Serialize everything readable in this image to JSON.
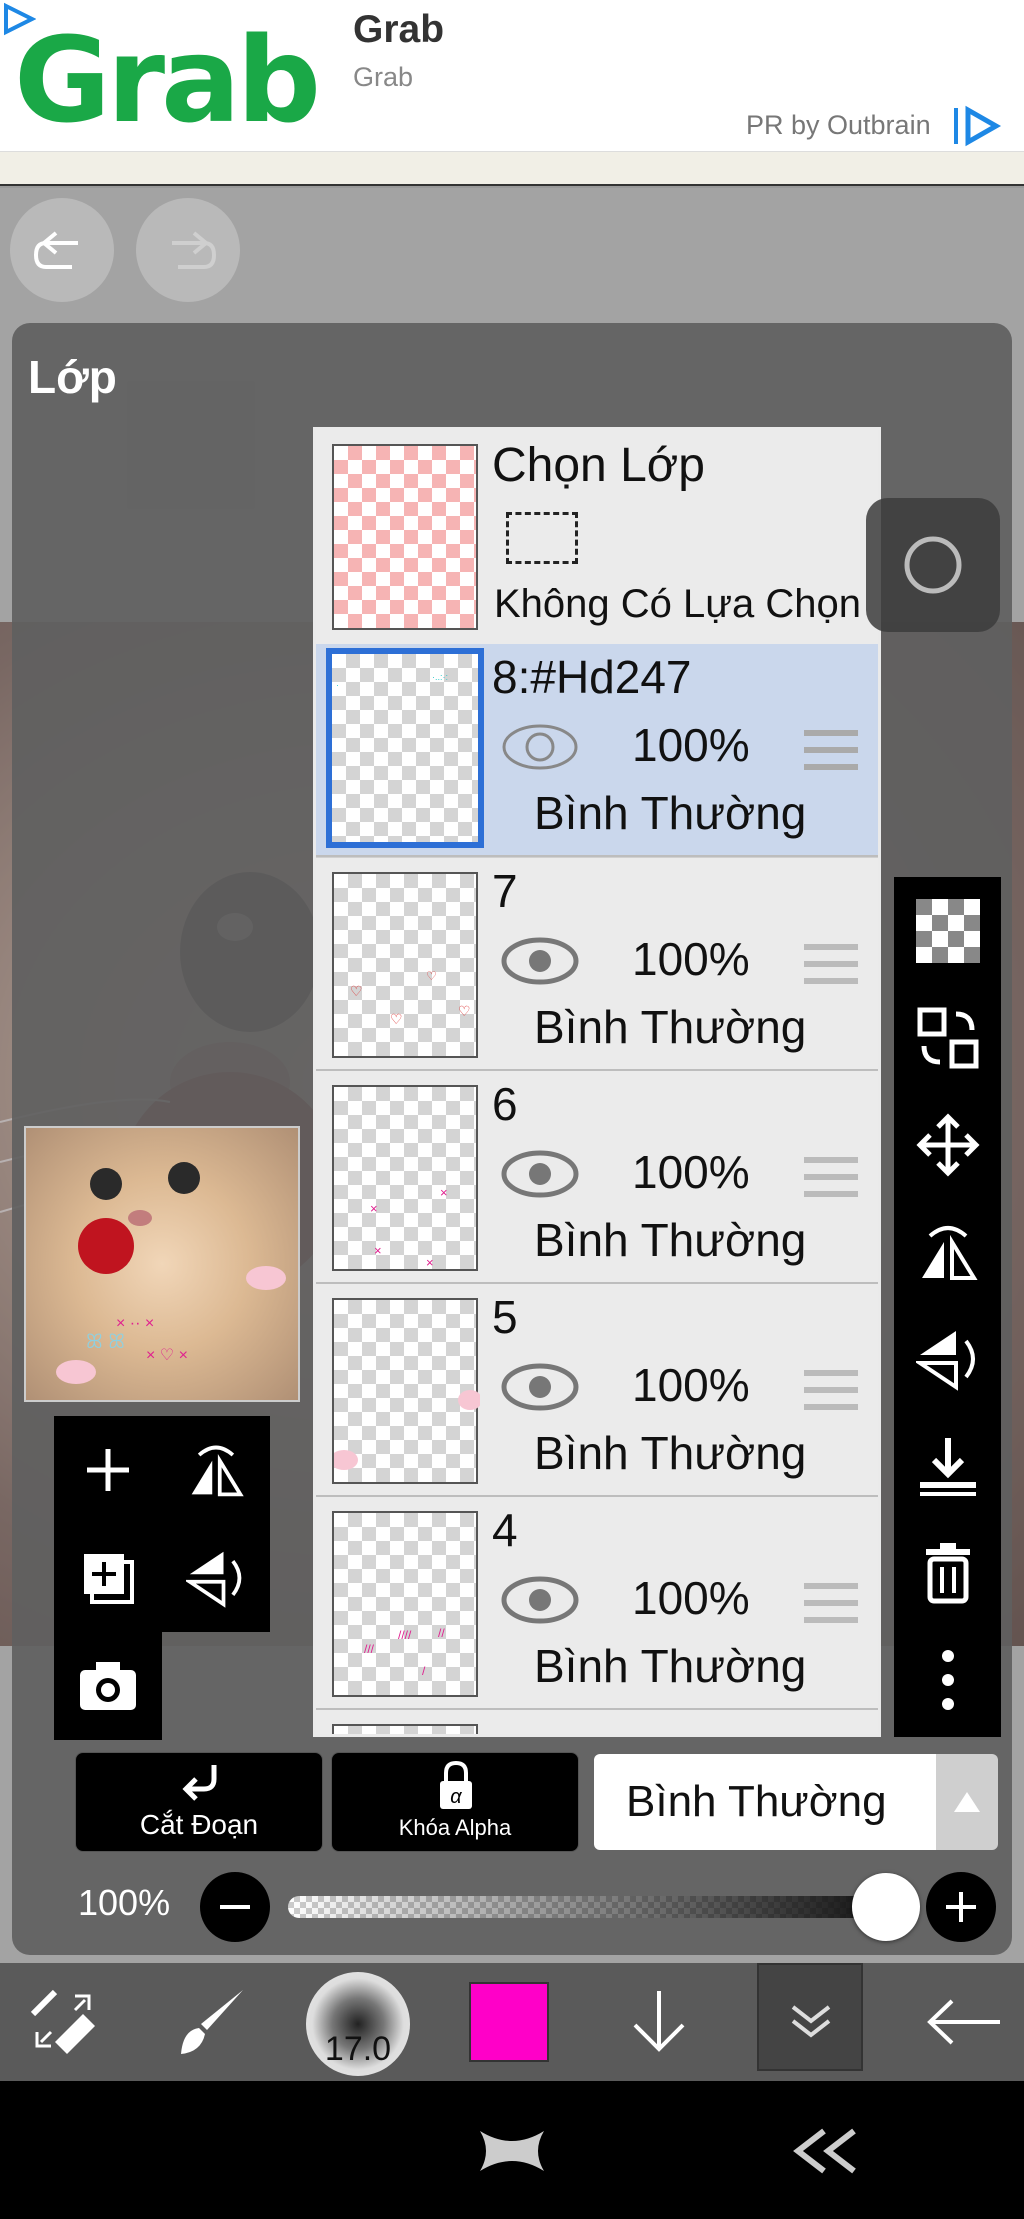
{
  "ad": {
    "logo_text": "Grab",
    "title": "Grab",
    "subtitle": "Grab",
    "sponsor": "PR by Outbrain",
    "brand_color": "#1aa847"
  },
  "history": {
    "undo_icon": "undo-icon",
    "redo_icon": "redo-icon"
  },
  "panel": {
    "title": "Lớp"
  },
  "selection_layer": {
    "title": "Chọn Lớp",
    "status": "Không Có Lựa Chọn"
  },
  "layers": [
    {
      "name": "8:#Hd247",
      "opacity": "100%",
      "blend": "Bình Thường",
      "active": true
    },
    {
      "name": "7",
      "opacity": "100%",
      "blend": "Bình Thường",
      "active": false
    },
    {
      "name": "6",
      "opacity": "100%",
      "blend": "Bình Thường",
      "active": false
    },
    {
      "name": "5",
      "opacity": "100%",
      "blend": "Bình Thường",
      "active": false
    },
    {
      "name": "4",
      "opacity": "100%",
      "blend": "Bình Thường",
      "active": false
    }
  ],
  "layer_actions": {
    "clip_label": "Cắt Đoạn",
    "alpha_lock_label": "Khóa Alpha",
    "blend_mode": "Bình Thường"
  },
  "opacity": {
    "label": "100%",
    "value": 1.0
  },
  "brush": {
    "size": "17.0",
    "color": "#ff00c8"
  },
  "right_tools": [
    "checker-icon",
    "swap-layer-icon",
    "move-icon",
    "flip-horizontal-icon",
    "flip-vertical-icon",
    "merge-down-icon",
    "trash-icon",
    "more-icon"
  ],
  "left_tools": [
    "add-layer-icon",
    "flip-h-icon",
    "duplicate-layer-icon",
    "flip-v-icon",
    "camera-icon"
  ]
}
